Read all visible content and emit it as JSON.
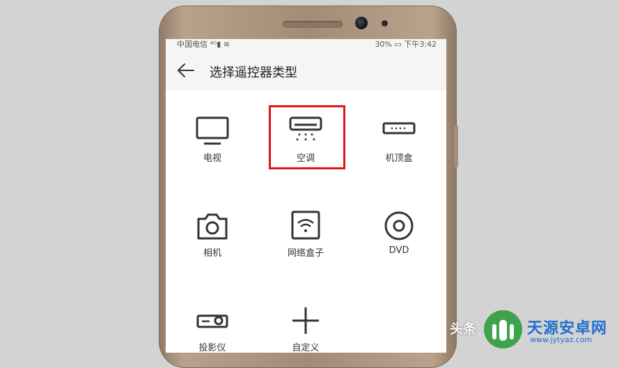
{
  "statusbar": {
    "carrier": "中国电信",
    "battery": "30%",
    "time": "下午3:42"
  },
  "header": {
    "title": "选择遥控器类型"
  },
  "devices": [
    {
      "label": "电视",
      "icon": "tv-icon"
    },
    {
      "label": "空调",
      "icon": "air-conditioner-icon"
    },
    {
      "label": "机顶盒",
      "icon": "set-top-box-icon"
    },
    {
      "label": "相机",
      "icon": "camera-icon"
    },
    {
      "label": "网络盒子",
      "icon": "network-box-icon"
    },
    {
      "label": "DVD",
      "icon": "dvd-icon"
    },
    {
      "label": "投影仪",
      "icon": "projector-icon"
    },
    {
      "label": "自定义",
      "icon": "plus-icon"
    }
  ],
  "highlight": {
    "target": "空调",
    "color": "#e0121b"
  },
  "watermark": {
    "toutiao": "头条",
    "site_name": "天源安卓网",
    "url": "www.jytyaz.com"
  }
}
